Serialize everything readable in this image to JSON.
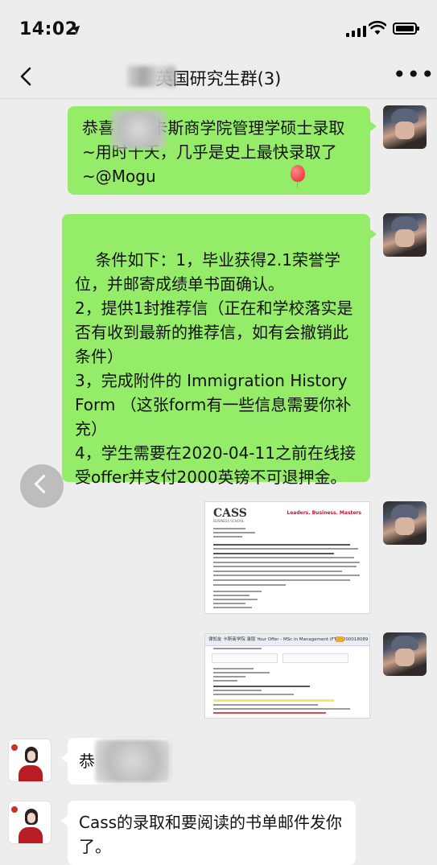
{
  "status_bar": {
    "time": "14:02",
    "location_arrow": "➤"
  },
  "nav": {
    "title": "英国研究生群(3)",
    "back_icon": "chevron-left-icon",
    "more_label": "•••"
  },
  "messages": [
    {
      "type": "text",
      "from": "me",
      "text": "恭喜 获得卡斯商学院管理学硕士录取~用时十天，几乎是史上最快录取了 ~@Mogu"
    },
    {
      "type": "text",
      "from": "me",
      "text": "条件如下：1，毕业获得2.1荣誉学位，并邮寄成绩单书面确认。\n2，提供1封推荐信（正在和学校落实是否有收到最新的推荐信，如有会撤销此条件）\n3，完成附件的 Immigration History Form （这张form有一些信息需要你补充）\n4，学生需要在2020-04-11之前在线接受offer并支付2000英镑不可退押金。"
    },
    {
      "type": "image",
      "from": "me",
      "doc_logo": "CASS",
      "doc_logo_sub": "BUSINESS SCHOOL",
      "doc_tag": "Leaders. Business. Masters"
    },
    {
      "type": "image",
      "from": "me",
      "mail_subject": "律知友 卡斯商学院 录取 Your Offer - MSc in Management (FT) - 200018089"
    },
    {
      "type": "text",
      "from": "agent",
      "text": "恭"
    },
    {
      "type": "text",
      "from": "agent",
      "text": "Cass的录取和要阅读的书单邮件发你了。"
    }
  ],
  "colors": {
    "background": "#ededed",
    "bubble_me": "#95ec69",
    "bubble_other": "#ffffff",
    "cass_red": "#c8102e"
  }
}
